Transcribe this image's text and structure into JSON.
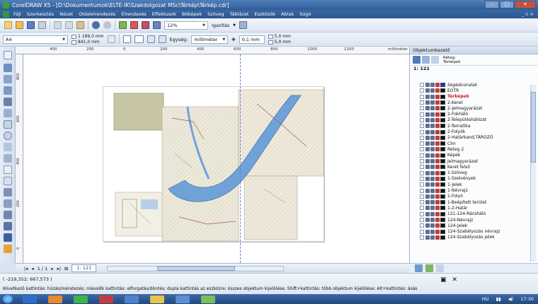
{
  "window": {
    "title": "CorelDRAW X5 - [D:\\Dokumentumok\\ELTE-IK\\Szakdolgozat MSc\\Térkép\\Térkép.cdr]",
    "btn_min": "–",
    "btn_max": "□",
    "btn_close": "✕"
  },
  "menubar": {
    "items": [
      "Fájl",
      "Szerkesztés",
      "Nézet",
      "Oldalelrendezés",
      "Elrendezés",
      "Effektusok",
      "Bitképek",
      "Szöveg",
      "Táblázat",
      "Eszközök",
      "Ablak",
      "Súgó"
    ],
    "right": "_ ▫ ×"
  },
  "toolbar1": {
    "zoom": "12%",
    "snap": "Igazítás"
  },
  "toolbar2": {
    "page_size": "A4",
    "width": "1 189,0 mm",
    "height": "841,0 mm",
    "units_label": "Egység:",
    "units": "milliméter",
    "nudge": "0,1 mm",
    "dup_x": "5,0 mm",
    "dup_y": "5,0 mm"
  },
  "ruler": {
    "h_ticks": [
      "400",
      "200",
      "0",
      "200",
      "400",
      "600",
      "800",
      "1000",
      "1200"
    ],
    "unit": "milliméter",
    "v_ticks": [
      "800",
      "600",
      "400",
      "200",
      "0"
    ]
  },
  "pages": {
    "nav": "1 / 1",
    "tab": "1: 121"
  },
  "object_manager": {
    "title": "Objektumkezelő",
    "layer_label": "Réteg:",
    "layer_value": "Térképek",
    "document": "1: 121",
    "layers": [
      {
        "name": "Segédvonalak",
        "style": "italic",
        "swatch": "#1d2bff"
      },
      {
        "name": "EOTR",
        "style": "normal",
        "swatch": "#111111"
      },
      {
        "name": "Térképek",
        "style": "active",
        "swatch": "#111111"
      },
      {
        "name": "2-Keret",
        "style": "normal",
        "swatch": "#111111"
      },
      {
        "name": "2-Jelmagyarázat",
        "style": "normal",
        "swatch": "#111111"
      },
      {
        "name": "2-Fokháló",
        "style": "normal",
        "swatch": "#111111"
      },
      {
        "name": "2-Településhálózat",
        "style": "normal",
        "swatch": "#111111"
      },
      {
        "name": "2-Tematika",
        "style": "normal",
        "swatch": "#111111"
      },
      {
        "name": "2-Folyók",
        "style": "normal",
        "swatch": "#111111"
      },
      {
        "name": "2-Határband,TÁROZÓ",
        "style": "normal",
        "swatch": "#111111"
      },
      {
        "name": "Cím",
        "style": "normal",
        "swatch": "#111111"
      },
      {
        "name": "Réteg 2",
        "style": "normal",
        "swatch": "#111111"
      },
      {
        "name": "Képek",
        "style": "normal",
        "swatch": "#111111"
      },
      {
        "name": "Jelmagyarázat",
        "style": "normal",
        "swatch": "#111111"
      },
      {
        "name": "Keret felső",
        "style": "normal",
        "swatch": "#111111"
      },
      {
        "name": "1-Szöveg",
        "style": "normal",
        "swatch": "#111111"
      },
      {
        "name": "1-Szelvények",
        "style": "normal",
        "swatch": "#111111"
      },
      {
        "name": "1-Jelek",
        "style": "normal",
        "swatch": "#111111"
      },
      {
        "name": "1-Névrajz",
        "style": "normal",
        "swatch": "#111111"
      },
      {
        "name": "1-Folyó",
        "style": "normal",
        "swatch": "#111111"
      },
      {
        "name": "1-Beépített terület",
        "style": "normal",
        "swatch": "#111111"
      },
      {
        "name": "1-2-Határ",
        "style": "normal",
        "swatch": "#111111"
      },
      {
        "name": "121-124-Rácsháló",
        "style": "normal",
        "swatch": "#111111"
      },
      {
        "name": "124-Névrajz",
        "style": "normal",
        "swatch": "#111111"
      },
      {
        "name": "124-Jelek",
        "style": "normal",
        "swatch": "#111111"
      },
      {
        "name": "124-Szabályozás névrajz",
        "style": "normal",
        "swatch": "#111111"
      },
      {
        "name": "124-Szabályozás jelek",
        "style": "normal",
        "swatch": "#111111"
      }
    ]
  },
  "status": {
    "coords": "( -219,352; 667,573 )",
    "hint": "Következő kattintás: húzás/méretezés; második kattintás: elforgatás/döntés; dupla kattintás az eszközre: összes objektum kijelölése; Shift+kattintás: több objektum kijelölése; Alt+kattintás: ásás"
  },
  "taskbar": {
    "lang": "HU",
    "time": "17:30"
  },
  "colors": {
    "river": "#6fa3d8",
    "map_paper": "#e9e4d3",
    "guide": "#6b7fd8"
  }
}
